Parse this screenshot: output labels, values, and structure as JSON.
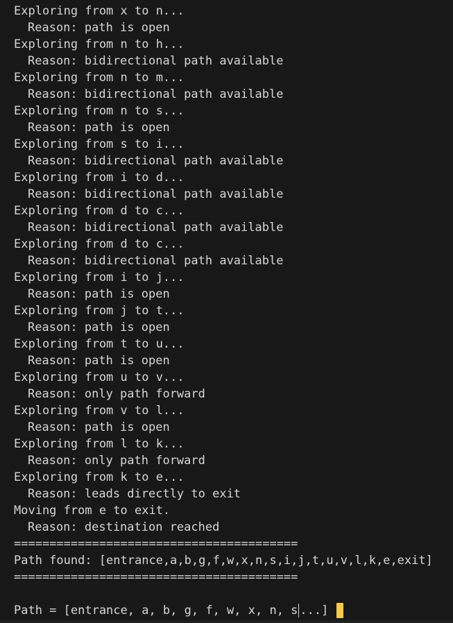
{
  "terminal": {
    "log": [
      {
        "kind": "explore",
        "text": "Exploring from x to n..."
      },
      {
        "kind": "reason",
        "text": "Reason: path is open"
      },
      {
        "kind": "explore",
        "text": "Exploring from n to h..."
      },
      {
        "kind": "reason",
        "text": "Reason: bidirectional path available"
      },
      {
        "kind": "explore",
        "text": "Exploring from n to m..."
      },
      {
        "kind": "reason",
        "text": "Reason: bidirectional path available"
      },
      {
        "kind": "explore",
        "text": "Exploring from n to s..."
      },
      {
        "kind": "reason",
        "text": "Reason: path is open"
      },
      {
        "kind": "explore",
        "text": "Exploring from s to i..."
      },
      {
        "kind": "reason",
        "text": "Reason: bidirectional path available"
      },
      {
        "kind": "explore",
        "text": "Exploring from i to d..."
      },
      {
        "kind": "reason",
        "text": "Reason: bidirectional path available"
      },
      {
        "kind": "explore",
        "text": "Exploring from d to c..."
      },
      {
        "kind": "reason",
        "text": "Reason: bidirectional path available"
      },
      {
        "kind": "explore",
        "text": "Exploring from d to c..."
      },
      {
        "kind": "reason",
        "text": "Reason: bidirectional path available"
      },
      {
        "kind": "explore",
        "text": "Exploring from i to j..."
      },
      {
        "kind": "reason",
        "text": "Reason: path is open"
      },
      {
        "kind": "explore",
        "text": "Exploring from j to t..."
      },
      {
        "kind": "reason",
        "text": "Reason: path is open"
      },
      {
        "kind": "explore",
        "text": "Exploring from t to u..."
      },
      {
        "kind": "reason",
        "text": "Reason: path is open"
      },
      {
        "kind": "explore",
        "text": "Exploring from u to v..."
      },
      {
        "kind": "reason",
        "text": "Reason: only path forward"
      },
      {
        "kind": "explore",
        "text": "Exploring from v to l..."
      },
      {
        "kind": "reason",
        "text": "Reason: path is open"
      },
      {
        "kind": "explore",
        "text": "Exploring from l to k..."
      },
      {
        "kind": "reason",
        "text": "Reason: only path forward"
      },
      {
        "kind": "explore",
        "text": "Exploring from k to e..."
      },
      {
        "kind": "reason",
        "text": "Reason: leads directly to exit"
      },
      {
        "kind": "explore",
        "text": "Moving from e to exit."
      },
      {
        "kind": "reason",
        "text": "Reason: destination reached"
      },
      {
        "kind": "separator",
        "text": "========================================"
      },
      {
        "kind": "result",
        "text": "Path found: [entrance,a,b,g,f,w,x,n,s,i,j,t,u,v,l,k,e,exit]"
      },
      {
        "kind": "separator",
        "text": "========================================"
      },
      {
        "kind": "blank",
        "text": ""
      }
    ],
    "prompt": {
      "before_cursor": "Path = [entrance, a, b, g, f, w, x, n, s",
      "after_cursor": "...]"
    },
    "colors": {
      "background": "#181818",
      "text": "#d6d6d6",
      "cursor": "#f5c94f"
    }
  }
}
